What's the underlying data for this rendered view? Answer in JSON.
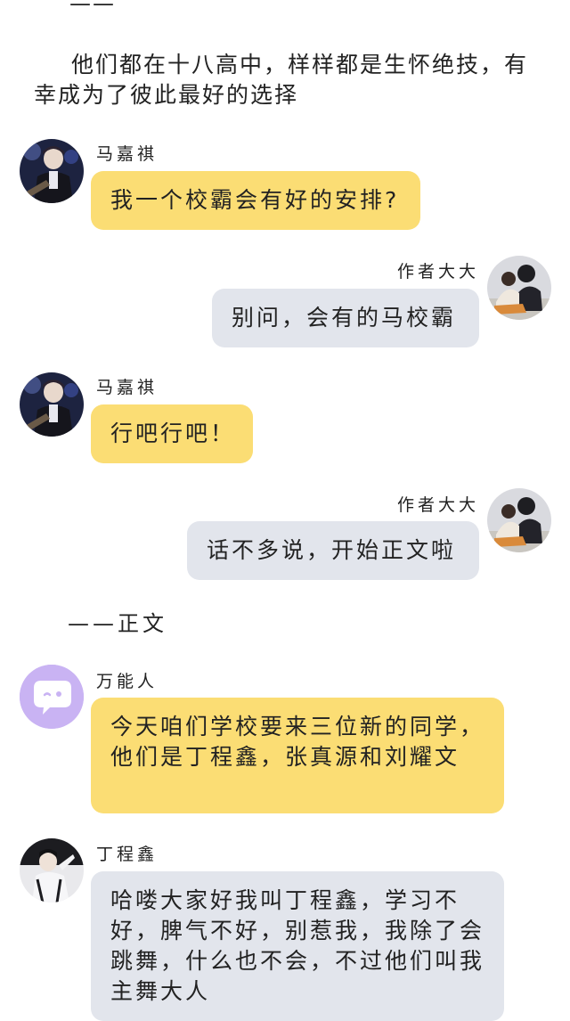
{
  "top_mark": "——",
  "intro_text": "他们都在十八高中，样样都是生怀绝技，有幸成为了彼此最好的选择",
  "section_title": "——正文",
  "messages": [
    {
      "sender": "马嘉祺",
      "text": "我一个校霸会有好的安排?"
    },
    {
      "sender": "作者大大",
      "text": "别问，会有的马校霸"
    },
    {
      "sender": "马嘉祺",
      "text": "行吧行吧！"
    },
    {
      "sender": "作者大大",
      "text": "话不多说，开始正文啦"
    },
    {
      "sender": "万能人",
      "text": "今天咱们学校要来三位新的同学，他们是丁程鑫，张真源和刘耀文"
    },
    {
      "sender": "丁程鑫",
      "text": "哈喽大家好我叫丁程鑫，学习不好，脾气不好，别惹我，我除了会跳舞，什么也不会，不过他们叫我主舞大人"
    }
  ],
  "colors": {
    "yellow_bubble": "#fbdd74",
    "grey_bubble": "#e2e5ec",
    "system_avatar": "#c9b3f3"
  },
  "icons": {
    "system_avatar": "chat-bubble-icon"
  }
}
